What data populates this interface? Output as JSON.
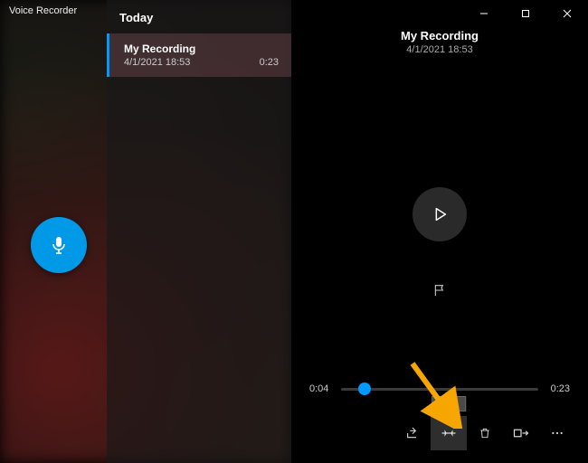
{
  "app_name": "Voice Recorder",
  "list": {
    "section": "Today",
    "items": [
      {
        "title": "My Recording",
        "datetime": "4/1/2021 18:53",
        "duration": "0:23"
      }
    ]
  },
  "detail": {
    "title": "My Recording",
    "datetime": "4/1/2021 18:53"
  },
  "timeline": {
    "position_label": "0:04",
    "duration_label": "0:23",
    "progress_percent": 12
  },
  "actions": {
    "trim_tooltip": "Trim"
  },
  "colors": {
    "accent": "#0099ff",
    "record": "#0099e8"
  }
}
